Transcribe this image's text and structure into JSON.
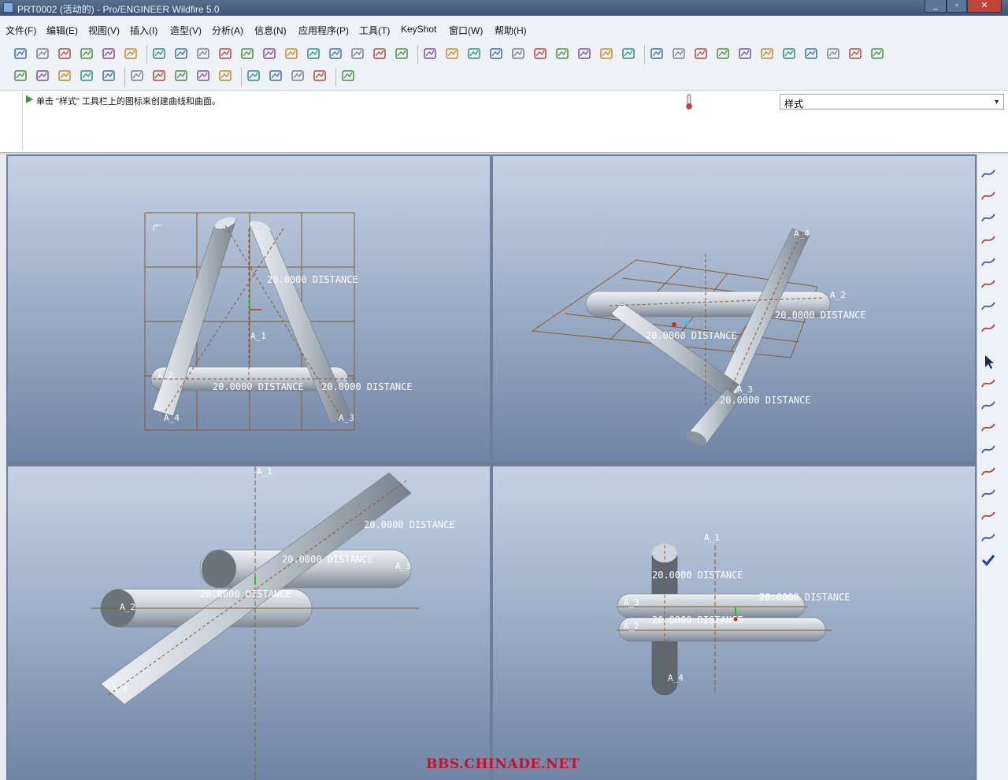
{
  "window": {
    "title": "PRT0002 (活动的) - Pro/ENGINEER Wildfire 5.0"
  },
  "menu": [
    "文件(F)",
    "编辑(E)",
    "视图(V)",
    "插入(I)",
    "造型(V)",
    "分析(A)",
    "信息(N)",
    "应用程序(P)",
    "工具(T)",
    "KeyShot",
    "窗口(W)",
    "帮助(H)"
  ],
  "message": {
    "text": "单击 \"样式\" 工具栏上的图标来创建曲线和曲面。"
  },
  "mode_combo": {
    "value": "样式"
  },
  "watermark": "BBS.CHINADE.NET",
  "viewports": {
    "top_left": {
      "labels": {
        "distance_1": "20.0000  DISTANCE",
        "distance_2": "20.0000  DISTANCE",
        "distance_3": "20.0000  DISTANCE",
        "axis_1": "A_1",
        "axis_2": "A_2",
        "axis_3": "A_3",
        "axis_4": "A_4"
      }
    },
    "top_right": {
      "labels": {
        "distance_1": "20.0000  DISTANCE",
        "distance_2": "20.0000  DISTANCE",
        "distance_3": "20.0000  DISTANCE",
        "axis_2": "A_2",
        "axis_3": "A_3",
        "axis_4": "A_4"
      }
    },
    "bottom_left": {
      "labels": {
        "distance_1": "20.0000  DISTANCE",
        "distance_2": "20.0000  DISTANCE",
        "distance_3": "20.0000  DISTANCE",
        "axis_1": "A_1",
        "axis_2": "A_2",
        "axis_3": "A_3",
        "axis_4": "A_4"
      }
    },
    "bottom_right": {
      "labels": {
        "distance_1": "20.0000  DISTANCE",
        "distance_2": "20.0000  DISTANCE",
        "distance_3": "20.0000  DISTANCE",
        "axis_1": "A_1",
        "axis_2": "A_2",
        "axis_3": "A_3",
        "axis_4": "A_4"
      }
    }
  },
  "colors": {
    "background_top": "#c4d2e3",
    "background_bottom": "#6f84a4",
    "grid": "#8a5a2e",
    "axis": "#8a5a2e",
    "cylinder": "#c9cfd6"
  },
  "toolbar_icons_row1": [
    "new-icon",
    "open-icon",
    "save-icon",
    "print-icon",
    "send-icon",
    "erase-icon",
    "dimension-icon",
    "datum-plane-icon",
    "table-icon",
    "circle-icon",
    "curve-icon",
    "surface-icon",
    "wave-icon",
    "color-icon",
    "shade-icon",
    "layers-icon",
    "measure-icon",
    "hatch-icon",
    "undo-icon",
    "redo-icon",
    "regenerate-icon",
    "cut-icon",
    "copy-icon",
    "paste-icon",
    "paste-special-icon",
    "render-icon",
    "find-icon",
    "select-box-icon",
    "datum-display-icon",
    "axis-display-icon",
    "point-display-icon",
    "sphere-icon",
    "zoom-in-icon",
    "zoom-out-icon",
    "refit-icon",
    "orient-icon",
    "saved-views-icon",
    "layer-icon",
    "model-tree-icon"
  ],
  "toolbar_icons_row2": [
    "view-iso-icon",
    "view-wire-icon",
    "view-hidden-icon",
    "view-shaded-icon",
    "model-display-icon",
    "plane-icon",
    "axis-icon",
    "point-icon",
    "csys-icon",
    "analysis-icon",
    "curve-analysis-icon",
    "surface-analysis-icon",
    "grid-icon",
    "style-icon",
    "help-icon"
  ],
  "right_toolbar": [
    "curve-icon",
    "plane-icon",
    "line-icon",
    "spline-icon",
    "points-icon",
    "intersect-icon",
    "sketch-icon",
    "link-icon",
    "select-arrow-icon",
    "active-plane-icon",
    "curve-create-icon",
    "curve-edit-icon",
    "surface-icon",
    "surface-edit-icon",
    "connect-icon",
    "trim-icon",
    "analysis-icon",
    "done-check-icon"
  ]
}
